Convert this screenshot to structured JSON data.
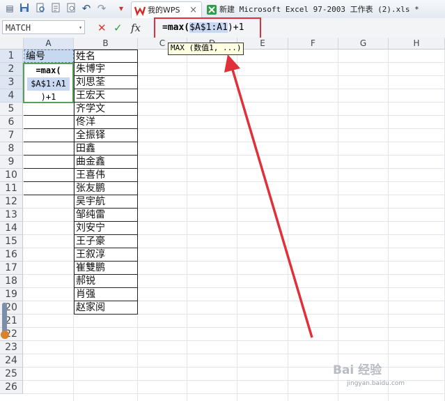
{
  "toolbar": {
    "icons": [
      "app-menu-icon",
      "save-icon",
      "print-preview-icon",
      "export-icon",
      "preview-icon",
      "undo-icon",
      "redo-icon",
      "format-painter-icon"
    ],
    "tabs": [
      {
        "label": "我的WPS",
        "close": "×"
      },
      {
        "label": "新建 Microsoft Excel 97-2003 工作表 (2).xls *"
      }
    ]
  },
  "formula_bar": {
    "name_box": "MATCH",
    "name_box_arrow": "▾",
    "cancel": "✕",
    "confirm": "✓",
    "fx": "fx",
    "formula_prefix": "=max(",
    "formula_ref": "$A$1:A1",
    "formula_suffix": ")+1"
  },
  "tooltip": {
    "text": "MAX (数值1, ...)"
  },
  "grid": {
    "columns": [
      "A",
      "B",
      "C",
      "D",
      "E",
      "F",
      "G",
      "H"
    ],
    "rows": [
      "1",
      "2",
      "3",
      "4",
      "5",
      "6",
      "7",
      "8",
      "9",
      "10",
      "11",
      "12",
      "13",
      "14",
      "15",
      "16",
      "17",
      "18",
      "19",
      "20",
      "21",
      "22",
      "23",
      "24",
      "25",
      "26"
    ],
    "cell_a1": "编号",
    "editor_lines": [
      "=max(",
      "$A$1:A1",
      ")+1"
    ],
    "names_header": "姓名",
    "names": [
      "朱博宇",
      "刘思荃",
      "王宏天",
      "齐学文",
      "佟洋",
      "全振铎",
      "田鑫",
      "曲金鑫",
      "王喜伟",
      "张友鹏",
      "吴宇航",
      "邹纯雷",
      "刘安宁",
      "王子豪",
      "王叙淳",
      "崔雙鹏",
      "郝锐",
      "肖强",
      "赵家阅"
    ]
  },
  "watermark": {
    "text": "Bai 经验",
    "sub": "jingyan.baidu.com"
  },
  "colors": {
    "highlight_box": "#e0303a",
    "arrow": "#e0303a",
    "edit_border": "#57a05a"
  }
}
